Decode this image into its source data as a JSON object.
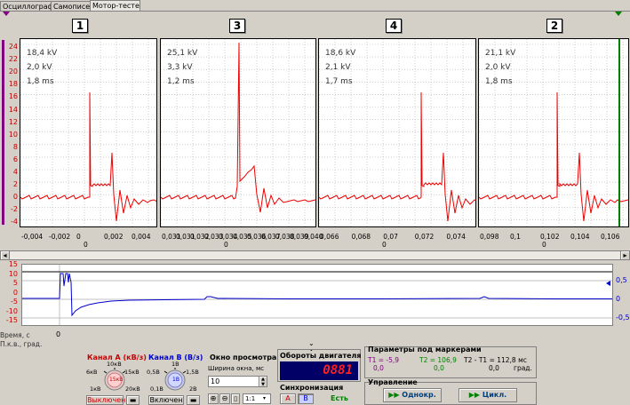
{
  "tabs": [
    {
      "label": "Осциллограф"
    },
    {
      "label": "Самописец"
    },
    {
      "label": "Мотор-тестер"
    }
  ],
  "y_axis_top": {
    "ticks": [
      "24",
      "22",
      "20",
      "18",
      "16",
      "14",
      "12",
      "10",
      "8",
      "6",
      "4",
      "2",
      "0",
      "-2",
      "-4"
    ]
  },
  "panels": [
    {
      "number": "1",
      "line1": "18,4 kV",
      "line2": "2,0 kV",
      "line3": "1,8 ms",
      "xticks": [
        "-0,004",
        "-0,002",
        "0",
        "0,002",
        "0,004"
      ],
      "zero": "0"
    },
    {
      "number": "3",
      "line1": "25,1 kV",
      "line2": "3,3 kV",
      "line3": "1,2 ms",
      "xticks": [
        "0,031",
        "0,031",
        "0,032",
        "0,033",
        "0,034",
        "0,035",
        "0,036",
        "0,037",
        "0,038",
        "0,039",
        "0,040"
      ],
      "zero": "0"
    },
    {
      "number": "4",
      "line1": "18,6 kV",
      "line2": "2,1 kV",
      "line3": "1,7 ms",
      "xticks": [
        "0,066",
        "0,068",
        "0,07",
        "0,072",
        "0,074"
      ],
      "zero": "0"
    },
    {
      "number": "2",
      "line1": "21,1 kV",
      "line2": "2,0 kV",
      "line3": "1,8 ms",
      "xticks": [
        "0,098",
        "0,1",
        "0,102",
        "0,104",
        "0,106"
      ],
      "zero": "0"
    }
  ],
  "lower_chart": {
    "left_ticks": [
      "15",
      "10",
      "5",
      "0",
      "-5",
      "-10",
      "-15"
    ],
    "right_ticks": [
      "0,5",
      "0",
      "-0,5"
    ],
    "zero_label": "0",
    "time_label": "Время, с",
    "angle_label": "П.к.в., град."
  },
  "channel_a": {
    "title": "Канал А (кВ/з)",
    "scale_10": "10кВ",
    "scale_15": "15кВ",
    "scale_6": "6кВ",
    "scale_1": "1кВ",
    "scale_20": "20кВ",
    "knob": "15кВ",
    "status": "Выключен"
  },
  "channel_b": {
    "title": "Канал B (В/з)",
    "scale_1": "1В",
    "scale_05": "0,5В",
    "scale_15": "1,5В",
    "scale_01": "0,1В",
    "scale_2": "2В",
    "knob": "1В",
    "status": "Включен"
  },
  "view_window": {
    "title": "Окно просмотра",
    "width_label": "Ширина окна, мс",
    "width_value": "10",
    "zoom_value": "1:1"
  },
  "rpm": {
    "title": "Обороты двигателя",
    "value": "0881"
  },
  "sync": {
    "title": "Синхронизация",
    "a": "A",
    "b": "B",
    "status": "Есть"
  },
  "markers": {
    "title": "Параметры под маркерами",
    "t1": "T1 = -5,9",
    "t1_val": "0,0",
    "t2": "T2 = 106,9",
    "t2_val": "0,0",
    "diff": "T2 - T1 = 112,8 мс",
    "diff_val": "0,0",
    "unit": "град."
  },
  "control": {
    "title": "Управление",
    "single": "Однокр.",
    "cycle": "Цикл."
  },
  "colors": {
    "signal": "#ee0000",
    "lower_signal": "#0000cc",
    "marker": "#008000",
    "lcd": "#000066",
    "lcd_text": "#ff2020"
  }
}
